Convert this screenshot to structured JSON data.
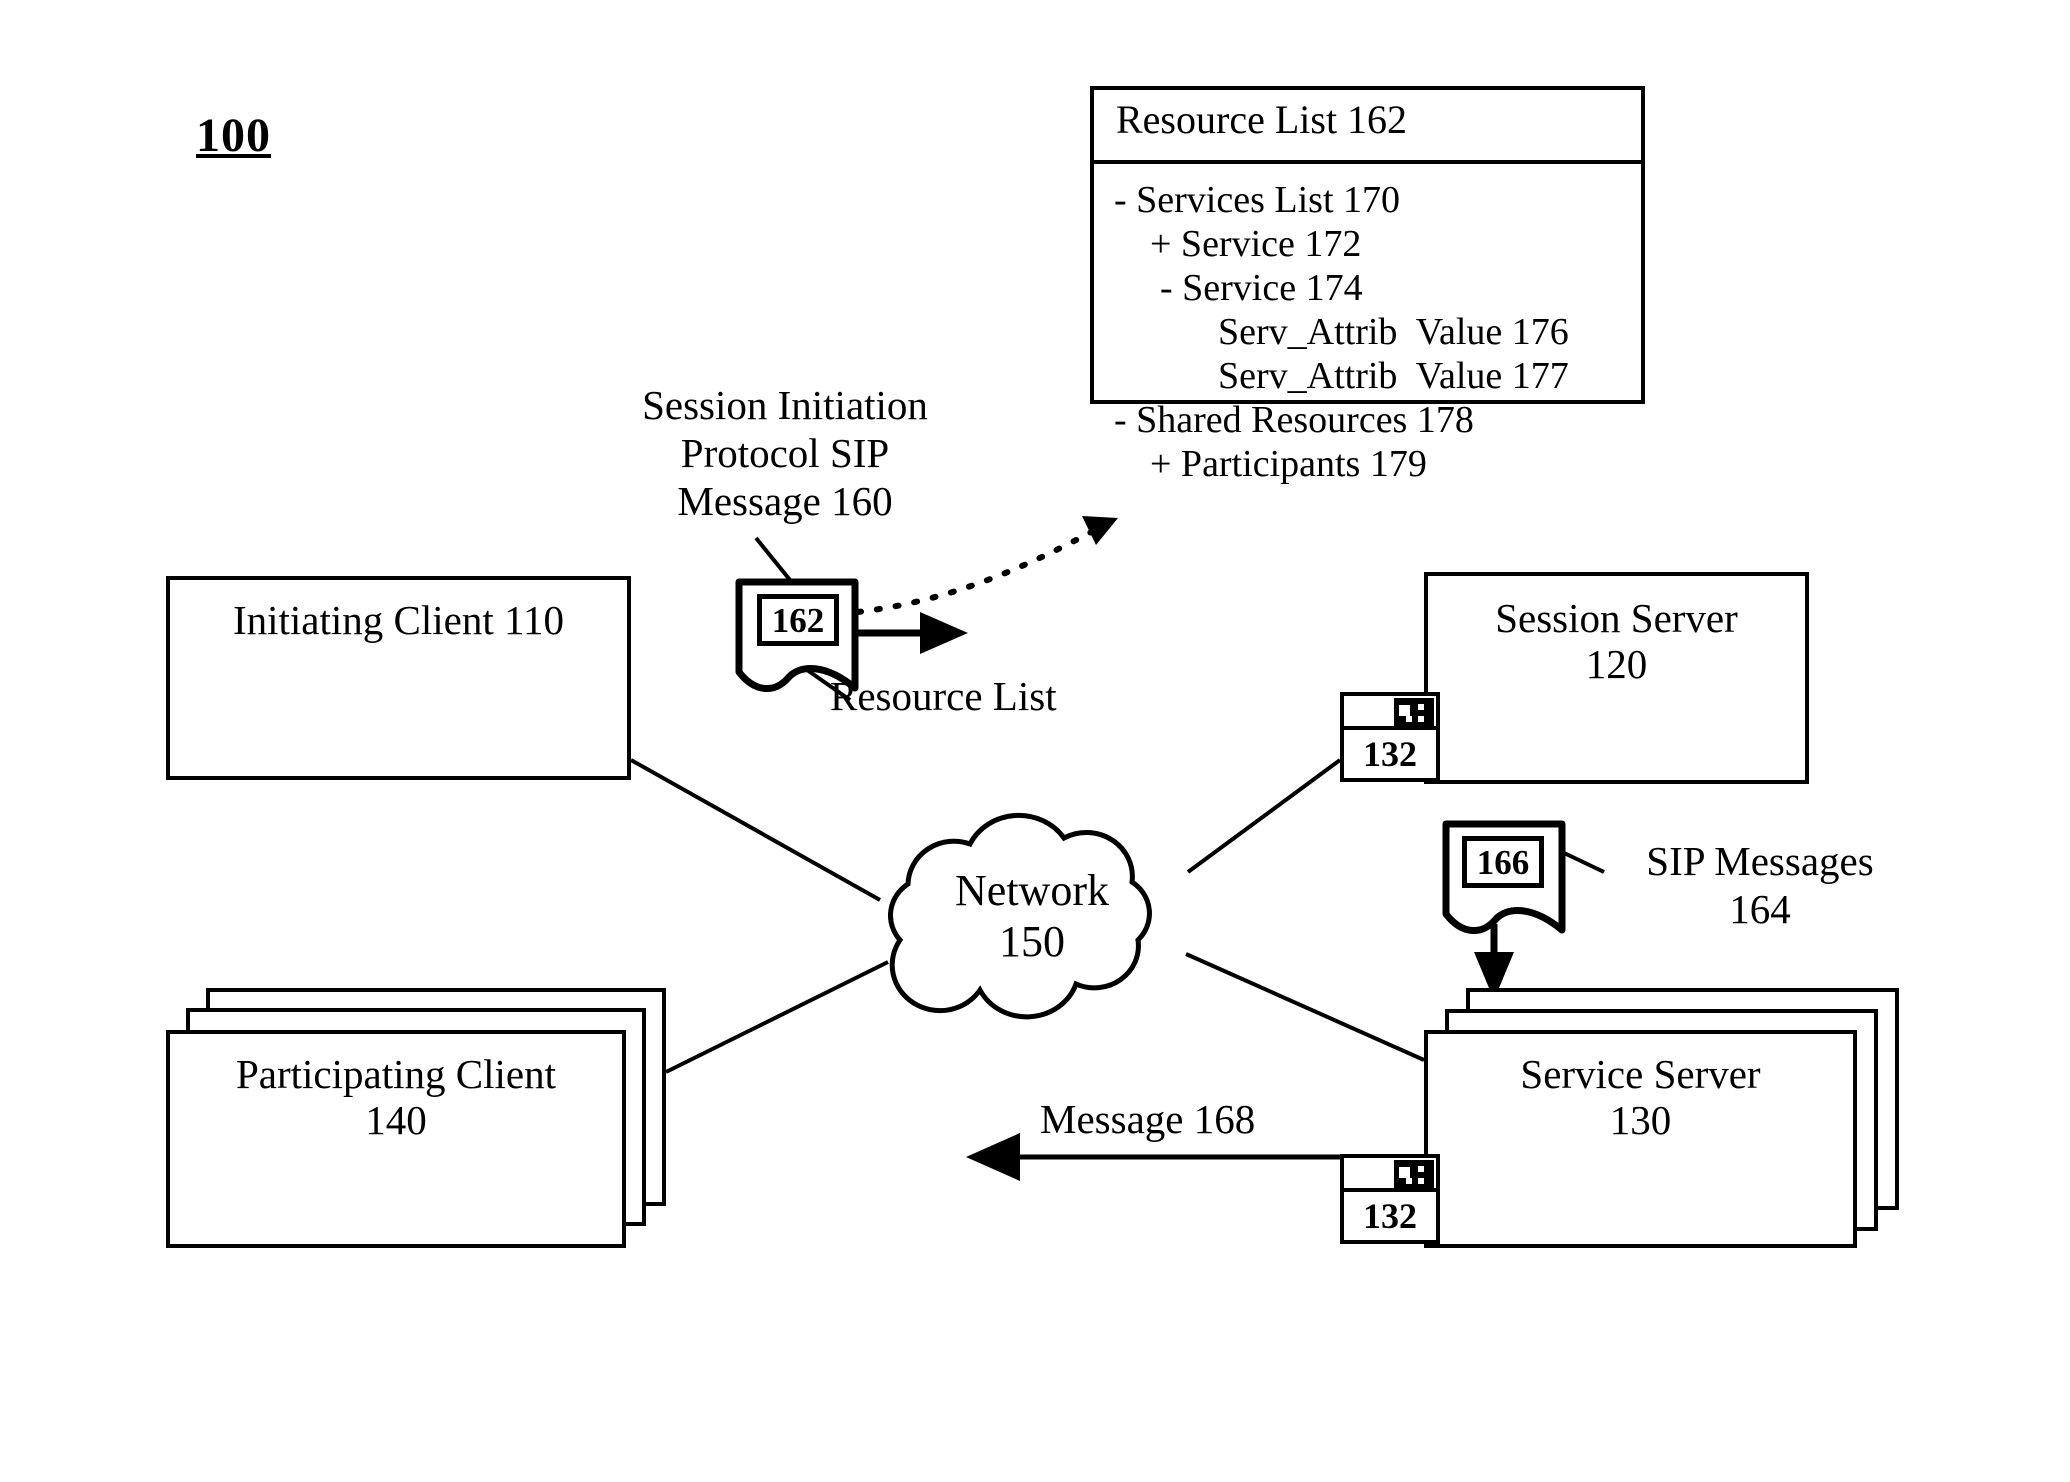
{
  "figure": {
    "number": "100"
  },
  "resource_list": {
    "header": "Resource List 162",
    "items": [
      {
        "text": "- Services List 170",
        "indent": 0
      },
      {
        "text": "+ Service 172",
        "indent": 1
      },
      {
        "text": "- Service 174",
        "indent": 2
      },
      {
        "text": "Serv_Attrib  Value 176",
        "indent": 3
      },
      {
        "text": "Serv_Attrib  Value 177",
        "indent": 3
      },
      {
        "text": "- Shared Resources 178",
        "indent": 0
      },
      {
        "text": "+ Participants 179",
        "indent": 1
      }
    ]
  },
  "labels": {
    "sip_message": "Session Initiation\nProtocol SIP\nMessage 160",
    "resource_list_caption": "Resource List",
    "sip_messages": "SIP Messages\n164",
    "message_168": "Message 168"
  },
  "nodes": {
    "initiating_client": {
      "title": "Initiating Client 110",
      "icons": [
        "desktop-computer-icon",
        "tower-pc-icon"
      ]
    },
    "session_server": {
      "title": "Session Server\n120",
      "icons": [
        "tower-server-icon"
      ],
      "adapter": "132"
    },
    "participating_client": {
      "title": "Participating Client\n140",
      "icons": [
        "desktop-computer-icon",
        "tower-pc-icon"
      ],
      "stack_count": 3
    },
    "service_server": {
      "title": "Service Server\n130",
      "icons": [
        "tower-server-icon"
      ],
      "adapter": "132",
      "stack_count": 3
    },
    "network": {
      "label": "Network\n150"
    }
  },
  "message_icons": {
    "resource_list_msg": "162",
    "sip_msg": "166"
  },
  "colors": {
    "ink": "#000000",
    "paper": "#ffffff"
  }
}
